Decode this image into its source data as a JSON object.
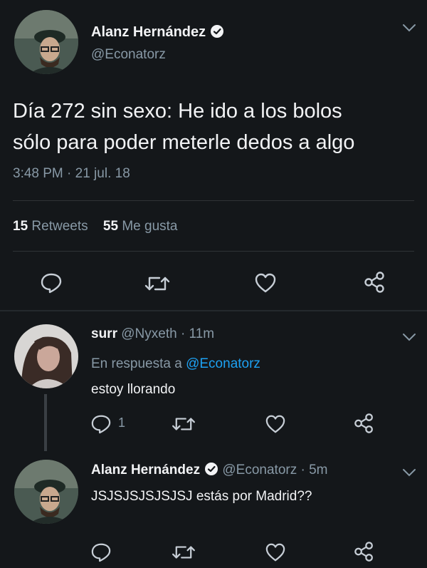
{
  "main_tweet": {
    "author_name": "Alanz Hernández",
    "handle": "@Econatorz",
    "text_line1": "Día 272 sin sexo: He ido a los bolos",
    "text_line2": "sólo para poder meterle dedos a algo",
    "timestamp": "3:48 PM · 21 jul. 18",
    "retweets_count": "15",
    "retweets_label": "Retweets",
    "likes_count": "55",
    "likes_label": "Me gusta"
  },
  "reply1": {
    "author_name": "surr",
    "handle": "@Nyxeth",
    "time": "· 11m",
    "replying_to_prefix": "En respuesta a",
    "replying_to_handle": "@Econatorz",
    "text": "estoy llorando",
    "reply_count": "1"
  },
  "reply2": {
    "author_name": "Alanz Hernández",
    "handle": "@Econatorz",
    "time": "· 5m",
    "text": "JSJSJSJSJSJSJ estás por Madrid??"
  },
  "colors": {
    "background": "#14171a",
    "muted": "#8899a6",
    "link": "#1da1f2",
    "divider": "#2f3336",
    "verified": "#f2f3f5"
  },
  "icons": {
    "reply": "reply-icon",
    "retweet": "retweet-icon",
    "like": "heart-icon",
    "share": "share-icon",
    "verified": "verified-badge-icon",
    "chevron": "chevron-down-icon"
  }
}
